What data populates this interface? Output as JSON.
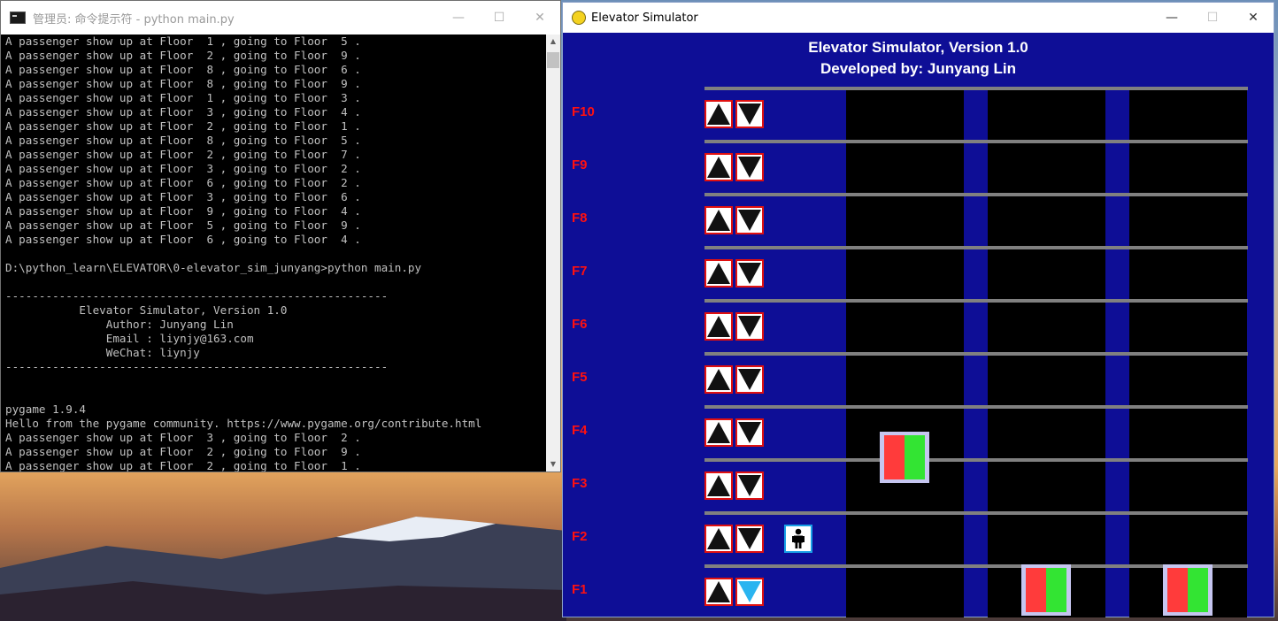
{
  "console": {
    "title": "管理员: 命令提示符 - python  main.py",
    "lines": [
      "A passenger show up at Floor  1 , going to Floor  5 .",
      "A passenger show up at Floor  2 , going to Floor  9 .",
      "A passenger show up at Floor  8 , going to Floor  6 .",
      "A passenger show up at Floor  8 , going to Floor  9 .",
      "A passenger show up at Floor  1 , going to Floor  3 .",
      "A passenger show up at Floor  3 , going to Floor  4 .",
      "A passenger show up at Floor  2 , going to Floor  1 .",
      "A passenger show up at Floor  8 , going to Floor  5 .",
      "A passenger show up at Floor  2 , going to Floor  7 .",
      "A passenger show up at Floor  3 , going to Floor  2 .",
      "A passenger show up at Floor  6 , going to Floor  2 .",
      "A passenger show up at Floor  3 , going to Floor  6 .",
      "A passenger show up at Floor  9 , going to Floor  4 .",
      "A passenger show up at Floor  5 , going to Floor  9 .",
      "A passenger show up at Floor  6 , going to Floor  4 .",
      "",
      "D:\\python_learn\\ELEVATOR\\0-elevator_sim_junyang>python main.py",
      "",
      "---------------------------------------------------------",
      "           Elevator Simulator, Version 1.0",
      "               Author: Junyang Lin",
      "               Email : liynjy@163.com",
      "               WeChat: liynjy",
      "---------------------------------------------------------",
      "",
      "",
      "pygame 1.9.4",
      "Hello from the pygame community. https://www.pygame.org/contribute.html",
      "A passenger show up at Floor  3 , going to Floor  2 .",
      "A passenger show up at Floor  2 , going to Floor  9 .",
      "A passenger show up at Floor  2 , going to Floor  1 ."
    ]
  },
  "elevator_window": {
    "title": "Elevator Simulator",
    "heading": "Elevator Simulator, Version 1.0",
    "subheading": "Developed by: Junyang Lin",
    "floors": [
      "F10",
      "F9",
      "F8",
      "F7",
      "F6",
      "F5",
      "F4",
      "F3",
      "F2",
      "F1"
    ],
    "active_down_button_floor": "F1",
    "waiting_passenger_floor": "F2",
    "elevators": [
      {
        "shaft": 1,
        "position_floor": 3.5
      },
      {
        "shaft": 2,
        "position_floor": 1
      },
      {
        "shaft": 3,
        "position_floor": 1
      }
    ],
    "colors": {
      "background": "#0e0e96",
      "floor_label": "#ff1010",
      "active_button": "#2ab4f0",
      "car_left": "#ff3b3b",
      "car_right": "#33e433"
    }
  },
  "window_controls": {
    "minimize": "—",
    "maximize": "☐",
    "close": "✕"
  }
}
